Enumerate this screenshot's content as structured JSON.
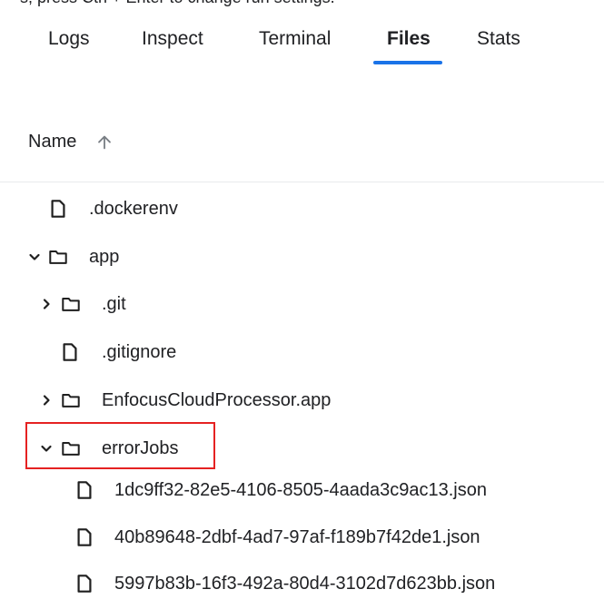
{
  "top_text": "s, press Ctrl + Enter to change run settings.",
  "tabs": [
    {
      "label": "Logs",
      "active": false
    },
    {
      "label": "Inspect",
      "active": false
    },
    {
      "label": "Terminal",
      "active": false
    },
    {
      "label": "Files",
      "active": true
    },
    {
      "label": "Stats",
      "active": false
    }
  ],
  "colors": {
    "accent": "#1a73e8",
    "highlight": "#e52222",
    "text": "#202124"
  },
  "file_list": {
    "column_header": "Name",
    "sort_direction": "ascending",
    "rows": [
      {
        "label": ".dockerenv",
        "type": "file"
      },
      {
        "label": "app",
        "type": "folder",
        "expanded": true
      },
      {
        "label": ".git",
        "type": "folder",
        "expanded": false
      },
      {
        "label": ".gitignore",
        "type": "file"
      },
      {
        "label": "EnfocusCloudProcessor.app",
        "type": "folder",
        "expanded": false
      },
      {
        "label": "errorJobs",
        "type": "folder",
        "expanded": true,
        "highlighted": true
      },
      {
        "label": "1dc9ff32-82e5-4106-8505-4aada3c9ac13.json",
        "type": "file"
      },
      {
        "label": "40b89648-2dbf-4ad7-97af-f189b7f42de1.json",
        "type": "file"
      },
      {
        "label": "5997b83b-16f3-492a-80d4-3102d7d623bb.json",
        "type": "file"
      }
    ]
  }
}
